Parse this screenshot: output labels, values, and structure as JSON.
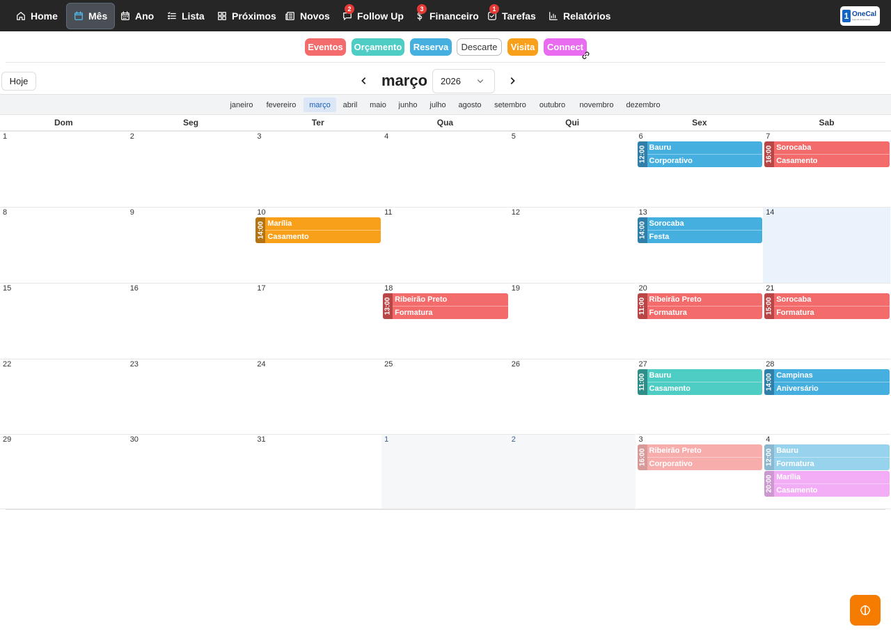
{
  "nav": {
    "items": [
      {
        "label": "Home",
        "icon": "home-icon"
      },
      {
        "label": "Mês",
        "icon": "calendar-icon",
        "active": true
      },
      {
        "label": "Ano",
        "icon": "calendar-grid-icon"
      },
      {
        "label": "Lista",
        "icon": "list-icon"
      },
      {
        "label": "Próximos",
        "icon": "grid-icon"
      },
      {
        "label": "Novos",
        "icon": "newspaper-icon"
      },
      {
        "label": "Follow Up",
        "icon": "chat-icon",
        "badge": "2"
      },
      {
        "label": "Financeiro",
        "icon": "dollar-icon",
        "badge": "3"
      },
      {
        "label": "Tarefas",
        "icon": "checkbox-icon",
        "badge": "1"
      },
      {
        "label": "Relatórios",
        "icon": "bar-chart-icon"
      }
    ],
    "logo": {
      "number": "1",
      "name": "OneCal",
      "tagline": "Agenda de Eventos"
    }
  },
  "filters": [
    {
      "label": "Eventos",
      "color": "#f36b6b"
    },
    {
      "label": "Orçamento",
      "color": "#4ecdc4"
    },
    {
      "label": "Reserva",
      "color": "#45b0e0"
    },
    {
      "label": "Descarte",
      "color": "#ffffff"
    },
    {
      "label": "Visita",
      "color": "#f9a01b"
    },
    {
      "label": "Connect",
      "color": "#e86bf0"
    }
  ],
  "header": {
    "today_label": "Hoje",
    "month": "março",
    "year": "2026",
    "prev": "‹",
    "next": "›"
  },
  "months": [
    "janeiro",
    "fevereiro",
    "março",
    "abril",
    "maio",
    "junho",
    "julho",
    "agosto",
    "setembro",
    "outubro",
    "novembro",
    "dezembro"
  ],
  "weekdays": [
    "Dom",
    "Seg",
    "Ter",
    "Qua",
    "Qui",
    "Sex",
    "Sab"
  ],
  "weeks": [
    [
      "1",
      "2",
      "3",
      "4",
      "5",
      "6",
      "7"
    ],
    [
      "8",
      "9",
      "10",
      "11",
      "12",
      "13",
      "14"
    ],
    [
      "15",
      "16",
      "17",
      "18",
      "19",
      "20",
      "21"
    ],
    [
      "22",
      "23",
      "24",
      "25",
      "26",
      "27",
      "28"
    ],
    [
      "29",
      "30",
      "31",
      "1",
      "2",
      "3",
      "4"
    ]
  ],
  "events": [
    {
      "week": 0,
      "day": 5,
      "slot": 0,
      "time": "12:00",
      "city": "Bauru",
      "type": "Corporativo",
      "color": "#45b0e0",
      "dark": "#2f7fa8"
    },
    {
      "week": 0,
      "day": 6,
      "slot": 0,
      "time": "16:00",
      "city": "Sorocaba",
      "type": "Casamento",
      "color": "#f36b6b",
      "dark": "#b94646"
    },
    {
      "week": 1,
      "day": 2,
      "slot": 0,
      "time": "14:00",
      "city": "Marília",
      "type": "Casamento",
      "color": "#f9a01b",
      "dark": "#b47412"
    },
    {
      "week": 1,
      "day": 5,
      "slot": 0,
      "time": "14:00",
      "city": "Sorocaba",
      "type": "Festa",
      "color": "#45b0e0",
      "dark": "#2f7fa8"
    },
    {
      "week": 2,
      "day": 3,
      "slot": 0,
      "time": "13:00",
      "city": "Ribeirão Preto",
      "type": "Formatura",
      "color": "#f36b6b",
      "dark": "#b94646"
    },
    {
      "week": 2,
      "day": 5,
      "slot": 0,
      "time": "11:00",
      "city": "Ribeirão Preto",
      "type": "Formatura",
      "color": "#f36b6b",
      "dark": "#b94646"
    },
    {
      "week": 2,
      "day": 6,
      "slot": 0,
      "time": "15:00",
      "city": "Sorocaba",
      "type": "Formatura",
      "color": "#f36b6b",
      "dark": "#b94646"
    },
    {
      "week": 3,
      "day": 5,
      "slot": 0,
      "time": "11:00",
      "city": "Bauru",
      "type": "Casamento",
      "color": "#4ecdc4",
      "dark": "#2f8f88"
    },
    {
      "week": 3,
      "day": 6,
      "slot": 0,
      "time": "14:00",
      "city": "Campinas",
      "type": "Aniversário",
      "color": "#45b0e0",
      "dark": "#2f7fa8"
    },
    {
      "week": 4,
      "day": 5,
      "slot": 0,
      "time": "16:00",
      "city": "Ribeirão Preto",
      "type": "Corporativo",
      "color": "#f36b6b",
      "dark": "#b94646",
      "faded": true
    },
    {
      "week": 4,
      "day": 6,
      "slot": 0,
      "time": "12:00",
      "city": "Bauru",
      "type": "Formatura",
      "color": "#45b0e0",
      "dark": "#2f7fa8",
      "faded": true
    },
    {
      "week": 4,
      "day": 6,
      "slot": 1,
      "time": "20:00",
      "city": "Marília",
      "type": "Casamento",
      "color": "#e86bf0",
      "dark": "#a247a8",
      "faded": true
    }
  ],
  "today": {
    "week": 1,
    "day": 6
  },
  "fab_icon": "brain-icon"
}
